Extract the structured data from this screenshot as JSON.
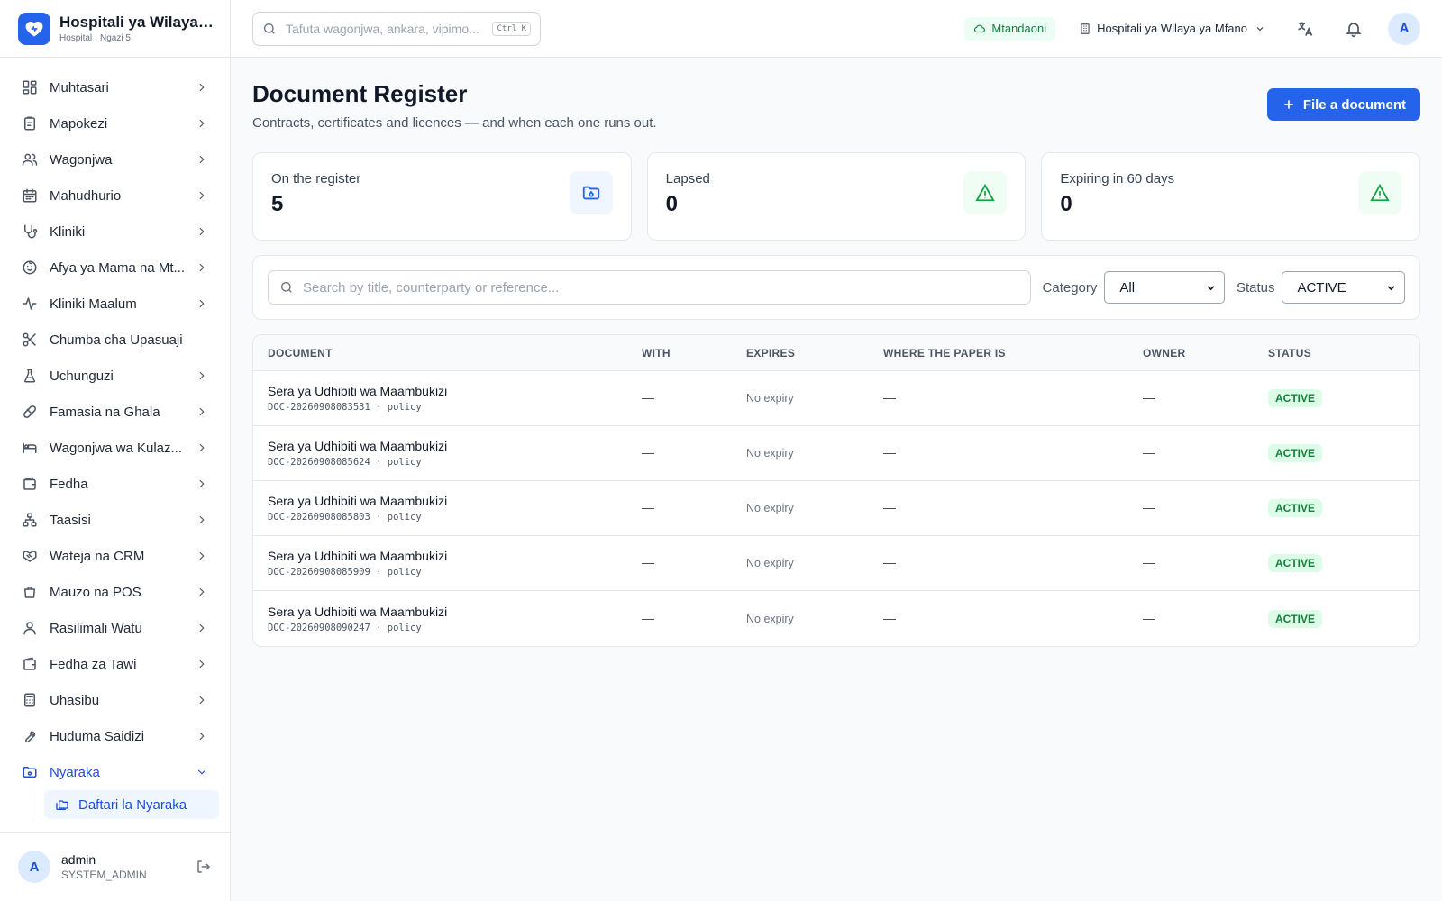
{
  "app": {
    "name": "Hospitali ya Wilaya ...",
    "subtitle": "Hospital · Ngazi 5"
  },
  "sidebar": {
    "items": [
      {
        "label": "Muhtasari",
        "icon": "dashboard-icon"
      },
      {
        "label": "Mapokezi",
        "icon": "clipboard-icon"
      },
      {
        "label": "Wagonjwa",
        "icon": "users-icon"
      },
      {
        "label": "Mahudhurio",
        "icon": "calendar-icon"
      },
      {
        "label": "Kliniki",
        "icon": "stethoscope-icon"
      },
      {
        "label": "Afya ya Mama na Mt...",
        "icon": "baby-icon"
      },
      {
        "label": "Kliniki Maalum",
        "icon": "activity-icon"
      },
      {
        "label": "Chumba cha Upasuaji",
        "icon": "scissors-icon"
      },
      {
        "label": "Uchunguzi",
        "icon": "flask-icon"
      },
      {
        "label": "Famasia na Ghala",
        "icon": "pill-icon"
      },
      {
        "label": "Wagonjwa wa Kulaz...",
        "icon": "bed-icon"
      },
      {
        "label": "Fedha",
        "icon": "wallet-icon"
      },
      {
        "label": "Taasisi",
        "icon": "network-icon"
      },
      {
        "label": "Wateja na CRM",
        "icon": "handshake-icon"
      },
      {
        "label": "Mauzo na POS",
        "icon": "shopping-bag-icon"
      },
      {
        "label": "Rasilimali Watu",
        "icon": "user-icon"
      },
      {
        "label": "Fedha za Tawi",
        "icon": "wallet-icon"
      },
      {
        "label": "Uhasibu",
        "icon": "calculator-icon"
      },
      {
        "label": "Huduma Saidizi",
        "icon": "wrench-icon"
      }
    ],
    "open_section": {
      "label": "Nyaraka",
      "icon": "folder-icon"
    },
    "sub_item": {
      "label": "Daftari la Nyaraka",
      "icon": "folders-icon"
    },
    "user": {
      "name": "admin",
      "role": "SYSTEM_ADMIN",
      "initial": "A"
    }
  },
  "topbar": {
    "search_placeholder": "Tafuta wagonjwa, ankara, vipimo...",
    "shortcut": "Ctrl K",
    "status": "Mtandaoni",
    "facility": "Hospitali ya Wilaya ya Mfano",
    "avatar_initial": "A"
  },
  "page": {
    "title": "Document Register",
    "subtitle": "Contracts, certificates and licences — and when each one runs out.",
    "primary_button": "File a document"
  },
  "stats": [
    {
      "label": "On the register",
      "value": "5",
      "icon": "folder-icon",
      "color": "#2563eb"
    },
    {
      "label": "Lapsed",
      "value": "0",
      "icon": "alert-triangle-icon",
      "color": "#16a34a"
    },
    {
      "label": "Expiring in 60 days",
      "value": "0",
      "icon": "alert-triangle-icon",
      "color": "#16a34a"
    }
  ],
  "filters": {
    "search_placeholder": "Search by title, counterparty or reference...",
    "category_label": "Category",
    "category_value": "All",
    "status_label": "Status",
    "status_value": "ACTIVE"
  },
  "table": {
    "columns": [
      "DOCUMENT",
      "WITH",
      "EXPIRES",
      "WHERE THE PAPER IS",
      "OWNER",
      "STATUS"
    ],
    "rows": [
      {
        "title": "Sera ya Udhibiti wa Maambukizi",
        "ref": "DOC-20260908083531 · policy",
        "with": "—",
        "expires": "No expiry",
        "where": "—",
        "owner": "—",
        "status": "ACTIVE"
      },
      {
        "title": "Sera ya Udhibiti wa Maambukizi",
        "ref": "DOC-20260908085624 · policy",
        "with": "—",
        "expires": "No expiry",
        "where": "—",
        "owner": "—",
        "status": "ACTIVE"
      },
      {
        "title": "Sera ya Udhibiti wa Maambukizi",
        "ref": "DOC-20260908085803 · policy",
        "with": "—",
        "expires": "No expiry",
        "where": "—",
        "owner": "—",
        "status": "ACTIVE"
      },
      {
        "title": "Sera ya Udhibiti wa Maambukizi",
        "ref": "DOC-20260908085909 · policy",
        "with": "—",
        "expires": "No expiry",
        "where": "—",
        "owner": "—",
        "status": "ACTIVE"
      },
      {
        "title": "Sera ya Udhibiti wa Maambukizi",
        "ref": "DOC-20260908090247 · policy",
        "with": "—",
        "expires": "No expiry",
        "where": "—",
        "owner": "—",
        "status": "ACTIVE"
      }
    ]
  },
  "colors": {
    "accent": "#2563eb",
    "success": "#16a34a",
    "success_bg": "#dcfce7"
  }
}
